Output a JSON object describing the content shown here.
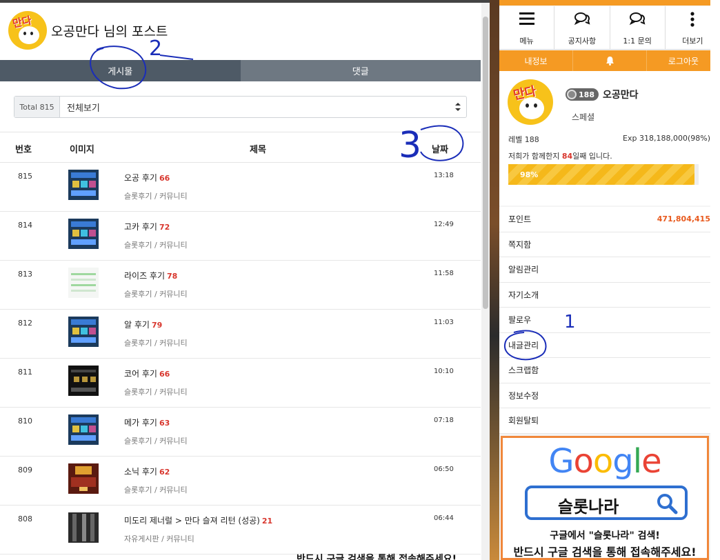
{
  "left_panel": {
    "title": "오공만다 님의 포스트",
    "avatar_text": "만다",
    "tabs": [
      {
        "label": "게시물",
        "active": true
      },
      {
        "label": "댓글",
        "active": false
      }
    ],
    "filter": {
      "total": "Total 815",
      "selected": "전체보기"
    },
    "columns": {
      "num": "번호",
      "image": "이미지",
      "title": "제목",
      "date": "날짜"
    },
    "rows": [
      {
        "num": "815",
        "title": "오공 후기",
        "count": "66",
        "category": "슬롯후기 / 커뮤니티",
        "time": "13:18",
        "thumb": "slot-blue"
      },
      {
        "num": "814",
        "title": "고카 후기",
        "count": "72",
        "category": "슬롯후기 / 커뮤니티",
        "time": "12:49",
        "thumb": "slot-blue"
      },
      {
        "num": "813",
        "title": "라이즈 후기",
        "count": "78",
        "category": "슬롯후기 / 커뮤니티",
        "time": "11:58",
        "thumb": "slot-light"
      },
      {
        "num": "812",
        "title": "알 후기",
        "count": "79",
        "category": "슬롯후기 / 커뮤니티",
        "time": "11:03",
        "thumb": "slot-blue"
      },
      {
        "num": "811",
        "title": "코어 후기",
        "count": "66",
        "category": "슬롯후기 / 커뮤니티",
        "time": "10:10",
        "thumb": "slot-dark"
      },
      {
        "num": "810",
        "title": "메가 후기",
        "count": "63",
        "category": "슬롯후기 / 커뮤니티",
        "time": "07:18",
        "thumb": "slot-blue"
      },
      {
        "num": "809",
        "title": "소닉 후기",
        "count": "62",
        "category": "슬롯후기 / 커뮤니티",
        "time": "06:50",
        "thumb": "slot-red"
      },
      {
        "num": "808",
        "title": "미도리 제너럴 > 만다 슬져 리턴 (성공)",
        "count": "21",
        "category": "자유게시판 / 커뮤니티",
        "time": "06:44",
        "thumb": "slot-gray"
      }
    ]
  },
  "annotations": {
    "n2": "2",
    "n3": "3",
    "n1": "1"
  },
  "right_panel": {
    "nav": [
      {
        "label": "메뉴",
        "icon": "hamburger-icon"
      },
      {
        "label": "공지사항",
        "icon": "chat-icon"
      },
      {
        "label": "1:1 문의",
        "icon": "chat-icon"
      },
      {
        "label": "더보기",
        "icon": "kebab-icon"
      }
    ],
    "subnav": {
      "info": "내정보",
      "bell": "bell-icon",
      "logout": "로그아웃"
    },
    "profile": {
      "avatar_text": "만다",
      "level_badge": "188",
      "name": "오공만다",
      "grade": "스페셜",
      "level_text": "레벨 188",
      "exp_text": "Exp 318,188,000(98%)",
      "days_prefix": "저희가 함께한지",
      "days_value": "84",
      "days_suffix": "일째 입니다.",
      "progress_label": "98%",
      "progress": 98
    },
    "menu": [
      {
        "label": "포인트",
        "value": "471,804,415"
      },
      {
        "label": "쪽지함"
      },
      {
        "label": "알림관리"
      },
      {
        "label": "자기소개"
      },
      {
        "label": "팔로우"
      },
      {
        "label": "내글관리"
      },
      {
        "label": "스크랩함"
      },
      {
        "label": "정보수정"
      },
      {
        "label": "회원탈퇴"
      }
    ],
    "ad": {
      "logo": "Google",
      "search_text": "슬롯나라",
      "line1": "구글에서 \"슬롯나라\" 검색!",
      "line2": "반드시 구글 검색을 통해 접속해주세요!"
    }
  },
  "bottom_strip_text": "반드시 구글 검색을 통해 접속해주세요!",
  "colors": {
    "accent": "#f59a23",
    "tab_active": "#4e5a66",
    "count_red": "#d8362d",
    "points": "#e85a1e",
    "annotation": "#1a2db8"
  }
}
